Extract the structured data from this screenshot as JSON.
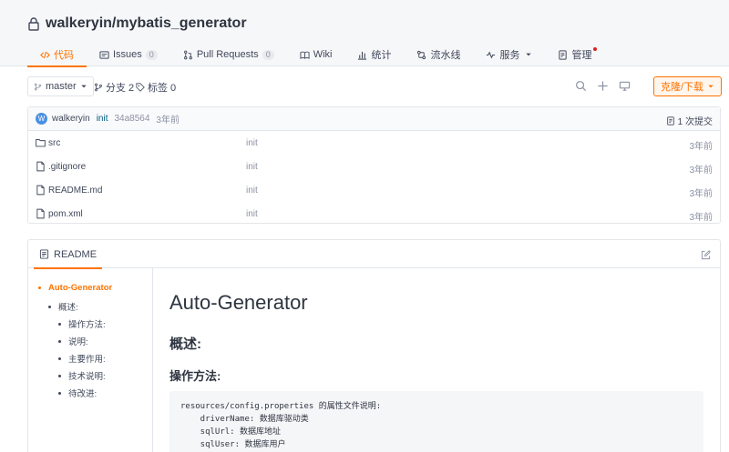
{
  "repo": {
    "title": "walkeryin/mybatis_generator"
  },
  "tabs": [
    {
      "label": "代码",
      "icon": "code-icon",
      "active": true
    },
    {
      "label": "Issues",
      "icon": "issues-icon",
      "badge": "0"
    },
    {
      "label": "Pull Requests",
      "icon": "pull-request-icon",
      "badge": "0"
    },
    {
      "label": "Wiki",
      "icon": "wiki-icon"
    },
    {
      "label": "统计",
      "icon": "stats-icon"
    },
    {
      "label": "流水线",
      "icon": "pipeline-icon"
    },
    {
      "label": "服务",
      "icon": "service-icon",
      "dropdown": true
    },
    {
      "label": "管理",
      "icon": "manage-icon",
      "dot": true
    }
  ],
  "toolbar": {
    "branch": "master",
    "branches_label": "分支 2",
    "tags_label": "标签 0",
    "clone_label": "克隆/下载"
  },
  "commit": {
    "avatar_letter": "W",
    "author": "walkeryin",
    "message": "init",
    "sha": "34a8564",
    "time": "3年前",
    "count_label": "1 次提交"
  },
  "files": [
    {
      "name": "src",
      "type": "folder",
      "message": "init",
      "time": "3年前"
    },
    {
      "name": ".gitignore",
      "type": "file",
      "message": "init",
      "time": "3年前"
    },
    {
      "name": "README.md",
      "type": "file",
      "message": "init",
      "time": "3年前"
    },
    {
      "name": "pom.xml",
      "type": "file",
      "message": "init",
      "time": "3年前"
    }
  ],
  "readme": {
    "tab_label": "README",
    "toc": [
      {
        "label": "Auto-Generator",
        "active": true
      },
      {
        "label": "概述:"
      },
      {
        "label": "操作方法:"
      },
      {
        "label": "说明:"
      },
      {
        "label": "主要作用:"
      },
      {
        "label": "技术说明:"
      },
      {
        "label": "待改进:"
      }
    ],
    "h1": "Auto-Generator",
    "h2": "概述:",
    "h3": "操作方法:",
    "code": [
      "resources/config.properties 的属性文件说明:",
      "    driverName: 数据库驱动类",
      "    sqlUrl: 数据库地址",
      "    sqlUser: 数据库用户"
    ]
  },
  "colors": {
    "accent": "#fe7300",
    "link": "#005980"
  }
}
